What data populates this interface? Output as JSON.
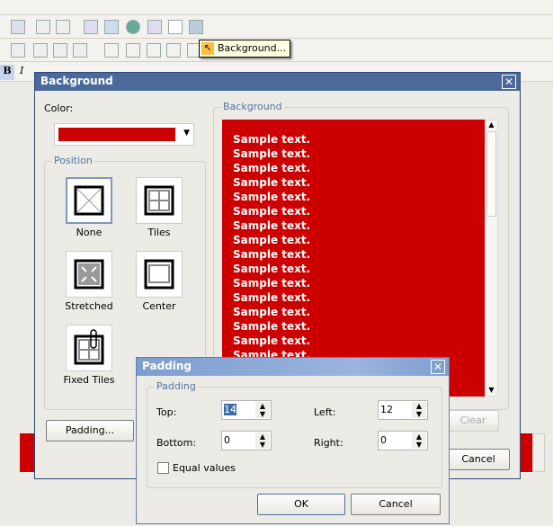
{
  "tooltip": {
    "text": "Background..."
  },
  "background_dialog": {
    "title": "Background",
    "color_label": "Color:",
    "color_value": "#cc0000",
    "position_group": "Position",
    "positions": [
      {
        "label": "None",
        "selected": true
      },
      {
        "label": "Tiles"
      },
      {
        "label": "Stretched"
      },
      {
        "label": "Center"
      },
      {
        "label": "Fixed Tiles"
      }
    ],
    "preview_group": "Background",
    "preview_lines": [
      "Sample text.",
      "Sample text.",
      "Sample text.",
      "Sample text.",
      "Sample text.",
      "Sample text.",
      "Sample text.",
      "Sample text.",
      "Sample text.",
      "Sample text.",
      "Sample text.",
      "Sample text.",
      "Sample text.",
      "Sample text.",
      "Sample text.",
      "Sample text."
    ],
    "padding_button": "Padding...",
    "clear_button": "Clear",
    "cancel_button": "Cancel"
  },
  "padding_dialog": {
    "title": "Padding",
    "group": "Padding",
    "top_label": "Top:",
    "top_value": "14",
    "left_label": "Left:",
    "left_value": "12",
    "bottom_label": "Bottom:",
    "bottom_value": "0",
    "right_label": "Right:",
    "right_value": "0",
    "equal_label": "Equal values",
    "equal_checked": false,
    "ok_button": "OK",
    "cancel_button": "Cancel"
  }
}
